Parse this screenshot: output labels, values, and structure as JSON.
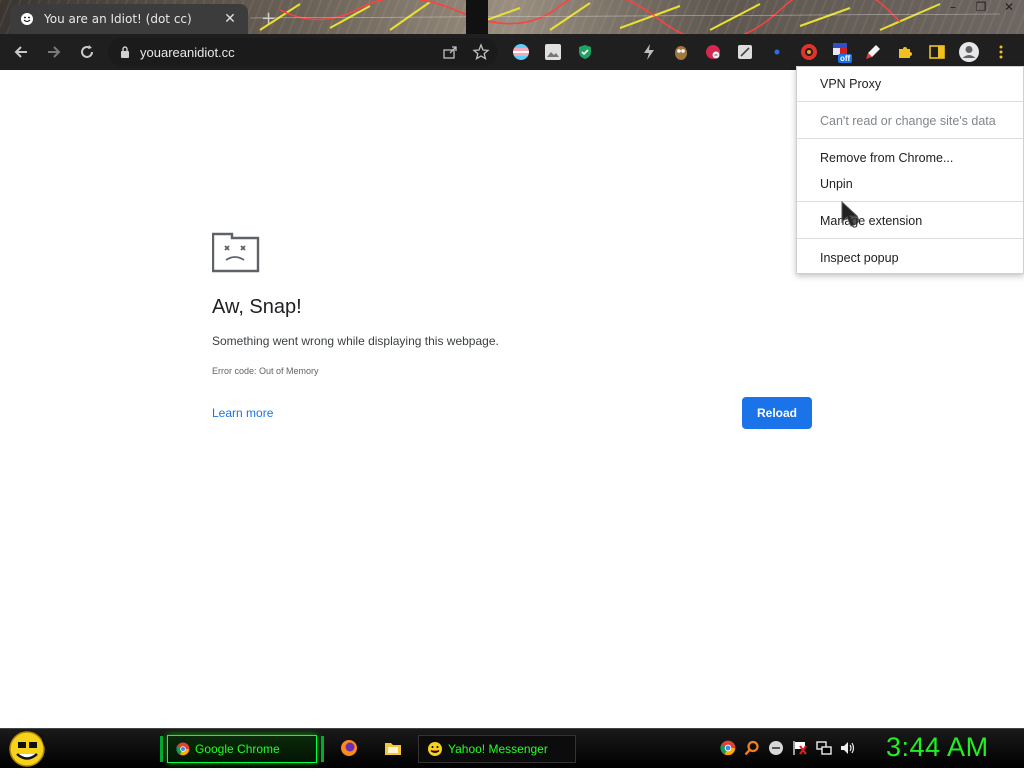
{
  "tab": {
    "title": "You are an Idiot! (dot cc)",
    "close": "✕",
    "new_tab": "+"
  },
  "window_controls": [
    "–",
    "❐",
    "✕"
  ],
  "omnibox": {
    "url": "youareanidiot.cc"
  },
  "extensions": [
    {
      "name": "trans-flag-extension-icon"
    },
    {
      "name": "image-extension-icon"
    },
    {
      "name": "shield-extension-icon"
    },
    {
      "name": "lightning-extension-icon"
    },
    {
      "name": "owl-extension-icon"
    },
    {
      "name": "red-extension-icon"
    },
    {
      "name": "script-extension-icon"
    },
    {
      "name": "dot-extension-icon"
    },
    {
      "name": "red-globe-extension-icon"
    },
    {
      "name": "vpn-proxy-extension-icon",
      "badge": "off"
    },
    {
      "name": "rocket-extension-icon"
    },
    {
      "name": "puzzle-extensions-icon"
    },
    {
      "name": "side-panel-icon"
    },
    {
      "name": "profile-avatar-icon"
    },
    {
      "name": "more-menu-icon"
    }
  ],
  "error_page": {
    "title": "Aw, Snap!",
    "message": "Something went wrong while displaying this webpage.",
    "code": "Error code: Out of Memory",
    "learn_more": "Learn more",
    "reload": "Reload"
  },
  "context_menu": {
    "items": [
      {
        "label": "VPN Proxy"
      },
      {
        "label": "Can't read or change site's data"
      },
      {
        "label": "Remove from Chrome..."
      },
      {
        "label": "Unpin"
      },
      {
        "label": "Manage extension"
      },
      {
        "label": "Inspect popup"
      }
    ]
  },
  "taskbar": {
    "chrome_label": "Google Chrome",
    "yahoo_label": "Yahoo! Messenger",
    "clock": "3:44 AM"
  },
  "colors": {
    "accent_blue": "#1a73e8",
    "taskbar_green": "#22ee22",
    "toolbar_bg": "#1f1f1f"
  }
}
